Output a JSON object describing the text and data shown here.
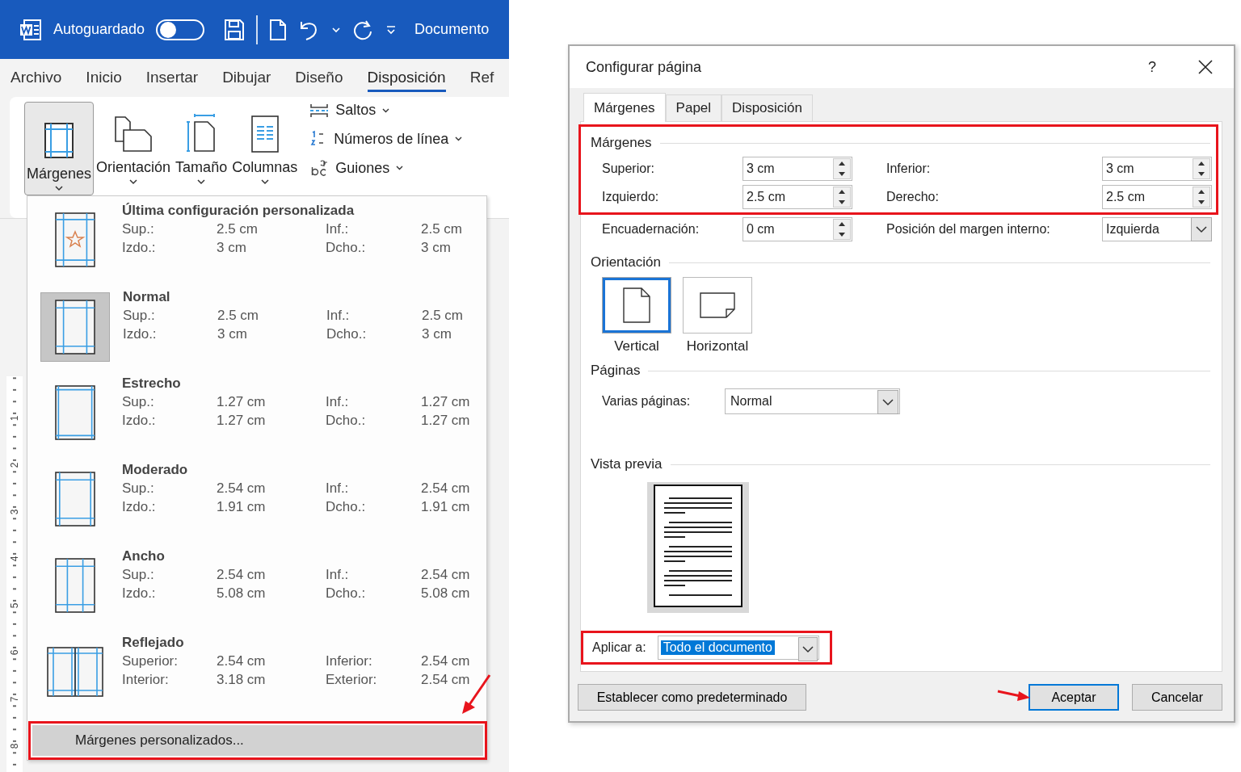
{
  "word": {
    "title_bar": {
      "autosave_label": "Autoguardado",
      "autosave_on": false,
      "document_title": "Documento"
    },
    "menu_tabs": [
      {
        "label": "Archivo",
        "selected": false
      },
      {
        "label": "Inicio",
        "selected": false
      },
      {
        "label": "Insertar",
        "selected": false
      },
      {
        "label": "Dibujar",
        "selected": false
      },
      {
        "label": "Diseño",
        "selected": false
      },
      {
        "label": "Disposición",
        "selected": true
      },
      {
        "label": "Ref",
        "selected": false
      }
    ],
    "ribbon": {
      "large_buttons": [
        {
          "label": "Márgenes",
          "kind": "margins",
          "selected": true
        },
        {
          "label": "Orientación",
          "kind": "orientation",
          "selected": false
        },
        {
          "label": "Tamaño",
          "kind": "size",
          "selected": false
        },
        {
          "label": "Columnas",
          "kind": "columns",
          "selected": false
        }
      ],
      "small_buttons": [
        {
          "label": "Saltos",
          "kind": "breaks"
        },
        {
          "label": "Números de línea",
          "kind": "line_numbers"
        },
        {
          "label": "Guiones",
          "kind": "hyphenation"
        }
      ]
    },
    "ruler": {
      "numbers": [
        "1",
        "2",
        "3",
        "4",
        "5",
        "6",
        "7",
        "8"
      ]
    },
    "margins_menu": {
      "presets": [
        {
          "name": "Última configuración personalizada",
          "kind": "custom",
          "selected": false,
          "rows": [
            [
              "Sup.:",
              "2.5 cm",
              "Inf.:",
              "2.5 cm"
            ],
            [
              "Izdo.:",
              "3 cm",
              "Dcho.:",
              "3 cm"
            ]
          ]
        },
        {
          "name": "Normal",
          "kind": "normal",
          "selected": true,
          "rows": [
            [
              "Sup.:",
              "2.5 cm",
              "Inf.:",
              "2.5 cm"
            ],
            [
              "Izdo.:",
              "3 cm",
              "Dcho.:",
              "3 cm"
            ]
          ]
        },
        {
          "name": "Estrecho",
          "kind": "narrow",
          "selected": false,
          "rows": [
            [
              "Sup.:",
              "1.27 cm",
              "Inf.:",
              "1.27 cm"
            ],
            [
              "Izdo.:",
              "1.27 cm",
              "Dcho.:",
              "1.27 cm"
            ]
          ]
        },
        {
          "name": "Moderado",
          "kind": "moderate",
          "selected": false,
          "rows": [
            [
              "Sup.:",
              "2.54 cm",
              "Inf.:",
              "2.54 cm"
            ],
            [
              "Izdo.:",
              "1.91 cm",
              "Dcho.:",
              "1.91 cm"
            ]
          ]
        },
        {
          "name": "Ancho",
          "kind": "wide",
          "selected": false,
          "rows": [
            [
              "Sup.:",
              "2.54 cm",
              "Inf.:",
              "2.54 cm"
            ],
            [
              "Izdo.:",
              "5.08 cm",
              "Dcho.:",
              "5.08 cm"
            ]
          ]
        },
        {
          "name": "Reflejado",
          "kind": "mirrored",
          "selected": false,
          "rows": [
            [
              "Superior:",
              "2.54 cm",
              "Inferior:",
              "2.54 cm"
            ],
            [
              "Interior:",
              "3.18 cm",
              "Exterior:",
              "2.54 cm"
            ]
          ]
        }
      ],
      "custom_margins": "Márgenes personalizados..."
    }
  },
  "dialog": {
    "title": "Configurar página",
    "help": "?",
    "tabs": [
      {
        "label": "Márgenes",
        "selected": true
      },
      {
        "label": "Papel",
        "selected": false
      },
      {
        "label": "Disposición",
        "selected": false
      }
    ],
    "margins_heading": "Márgenes",
    "margin_rows": [
      [
        {
          "label": "Superior:",
          "value": "3 cm",
          "kind": "spin"
        },
        {
          "label": "Inferior:",
          "value": "3 cm",
          "kind": "spin"
        }
      ],
      [
        {
          "label": "Izquierdo:",
          "value": "2.5 cm",
          "kind": "spin"
        },
        {
          "label": "Derecho:",
          "value": "2.5 cm",
          "kind": "spin"
        }
      ],
      [
        {
          "label": "Encuadernación:",
          "value": "0 cm",
          "kind": "spin"
        },
        {
          "label": "Posición del margen interno:",
          "value": "Izquierda",
          "kind": "dropdown"
        }
      ]
    ],
    "orientation_heading": "Orientación",
    "orientations": [
      {
        "label": "Vertical",
        "kind": "portrait",
        "selected": true
      },
      {
        "label": "Horizontal",
        "kind": "landscape",
        "selected": false
      }
    ],
    "pages_heading": "Páginas",
    "multiple_pages": {
      "label": "Varias páginas:",
      "value": "Normal"
    },
    "preview_heading": "Vista previa",
    "apply_to": {
      "label": "Aplicar a:",
      "value": "Todo el documento",
      "text_selected": true
    },
    "buttons": [
      {
        "label": "Establecer como predeterminado",
        "default": false
      },
      {
        "label": "Aceptar",
        "default": true
      },
      {
        "label": "Cancelar",
        "default": false
      }
    ]
  }
}
